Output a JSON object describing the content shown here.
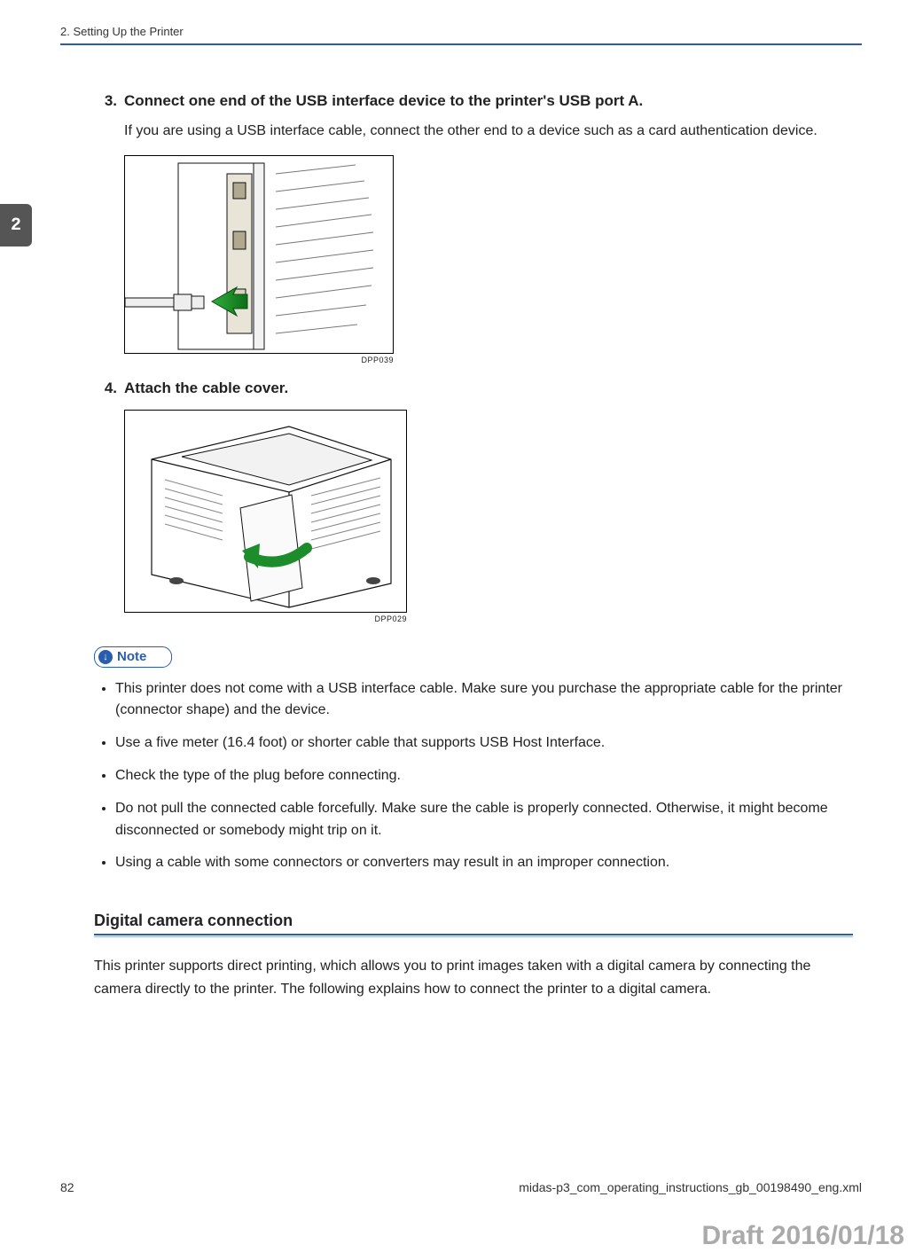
{
  "header": {
    "chapter_title": "2. Setting Up the Printer"
  },
  "sideTab": {
    "label": "2"
  },
  "steps": [
    {
      "num": "3.",
      "title": "Connect one end of the USB interface device to the printer's USB port A.",
      "desc": "If you are using a USB interface cable, connect the other end to a device such as a card authentication device.",
      "caption": "DPP039"
    },
    {
      "num": "4.",
      "title": "Attach the cable cover.",
      "desc": "",
      "caption": "DPP029"
    }
  ],
  "note": {
    "label": "Note",
    "items": [
      "This printer does not come with a USB interface cable. Make sure you purchase the appropriate cable for the printer (connector shape) and the device.",
      "Use a five meter (16.4 foot) or shorter cable that supports USB Host Interface.",
      "Check the type of the plug before connecting.",
      "Do not pull the connected cable forcefully. Make sure the cable is properly connected. Otherwise, it might become disconnected or somebody might trip on it.",
      "Using a cable with some connectors or converters may result in an improper connection."
    ]
  },
  "section": {
    "title": "Digital camera connection",
    "body": "This printer supports direct printing, which allows you to print images taken with a digital camera by connecting the camera directly to the printer. The following explains how to connect the printer to a digital camera."
  },
  "footer": {
    "pageNumber": "82",
    "filename": "midas-p3_com_operating_instructions_gb_00198490_eng.xml"
  },
  "watermark": "Draft 2016/01/18"
}
